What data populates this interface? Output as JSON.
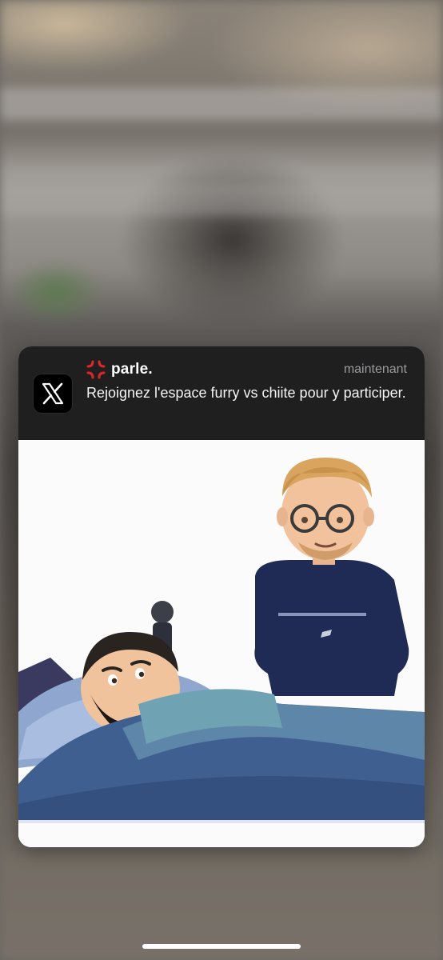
{
  "notification": {
    "app_icon": "x-logo-icon",
    "sender_emoji_icon": "anger-symbol-icon",
    "sender": "parle.",
    "time": "maintenant",
    "message": "Rejoignez l'espace furry vs chiite pour y participer.",
    "attachment": {
      "type": "image",
      "description_icon": "cartoon-illustration-image"
    }
  },
  "colors": {
    "header_bg": "#1f1f20",
    "sender_text": "#ffffff",
    "time_text": "#9b9b9f",
    "anger_icon": "#e0262b"
  },
  "system": {
    "home_indicator": "home-indicator"
  }
}
